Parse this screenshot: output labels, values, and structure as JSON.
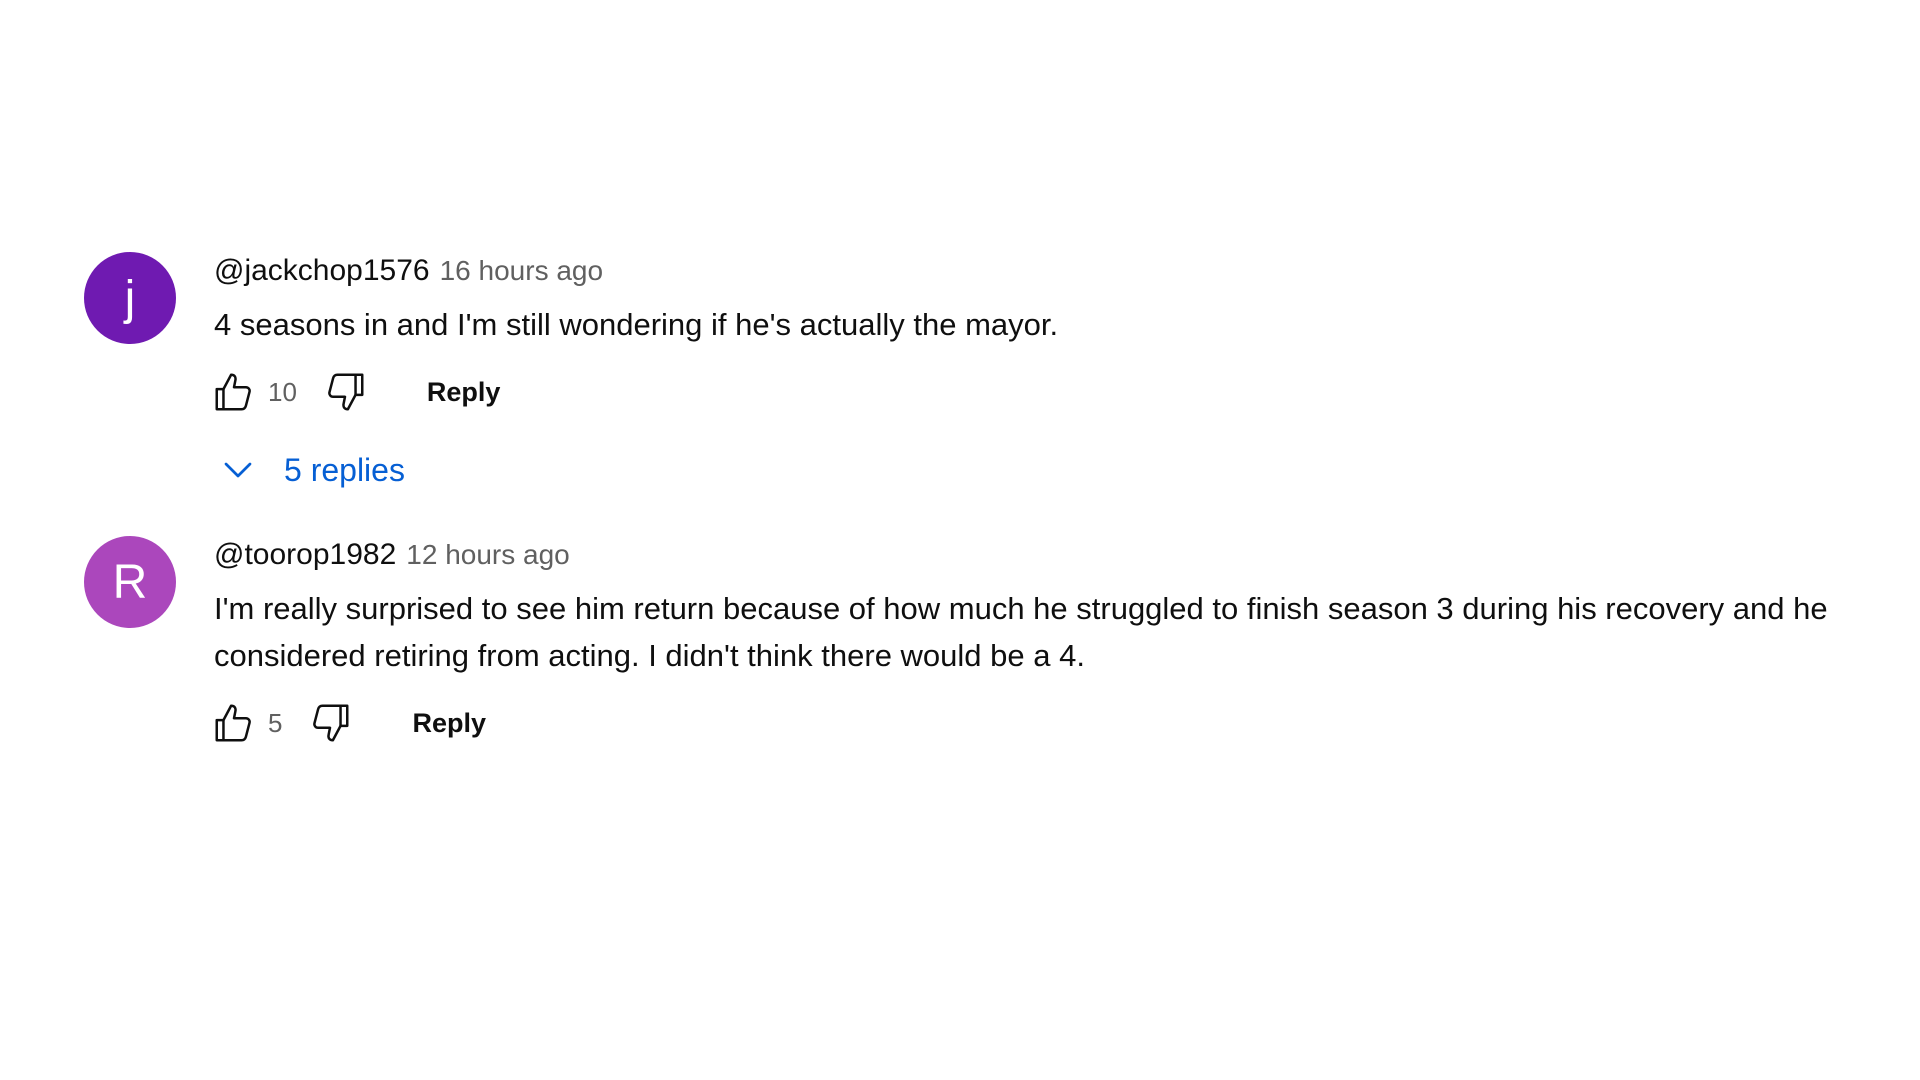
{
  "comments": [
    {
      "avatar_letter": "j",
      "avatar_color": "#6f1ab1",
      "author": "@jackchop1576",
      "time": "16 hours ago",
      "text": "4 seasons in and I'm still wondering if he's actually the mayor.",
      "like_count": "10",
      "reply_label": "Reply",
      "replies_label": "5 replies"
    },
    {
      "avatar_letter": "R",
      "avatar_color": "#ab47bc",
      "author": "@toorop1982",
      "time": "12 hours ago",
      "text": "I'm really surprised to see him return because of how much he struggled to finish season 3 during his recovery and he considered retiring from acting. I didn't think there would be a 4.",
      "like_count": "5",
      "reply_label": "Reply"
    }
  ],
  "icons": {
    "like": "thumbs-up-icon",
    "dislike": "thumbs-down-icon",
    "expand": "chevron-down-icon"
  },
  "colors": {
    "link": "#065fd4",
    "secondary_text": "#606060"
  }
}
